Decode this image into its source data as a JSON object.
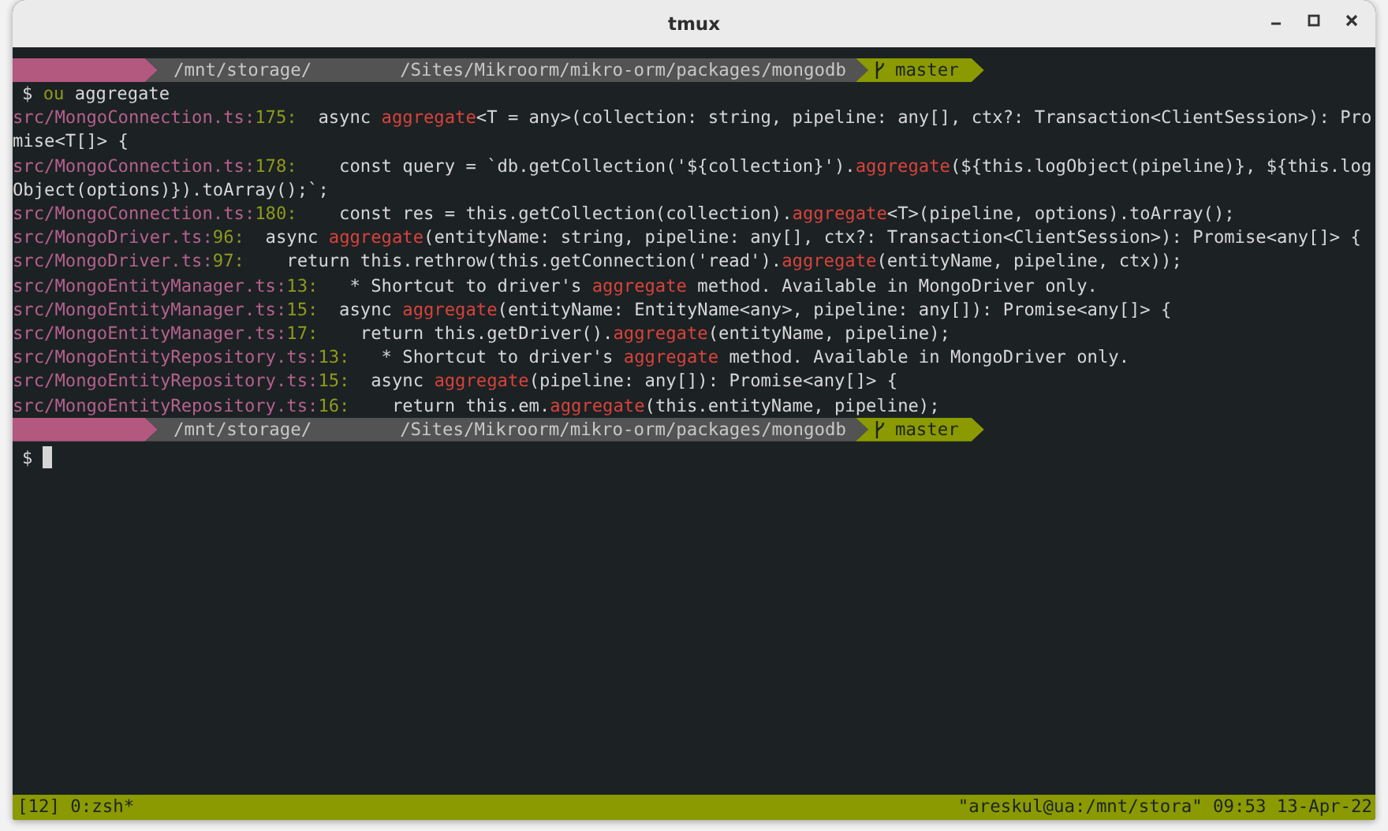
{
  "window": {
    "title": "tmux"
  },
  "prompts": [
    {
      "path_root": "/mnt/storage/",
      "path_rest": "/Sites/Mikroorm/mikro-orm/packages/mongodb",
      "branch": "master"
    },
    {
      "path_root": "/mnt/storage/",
      "path_rest": "/Sites/Mikroorm/mikro-orm/packages/mongodb",
      "branch": "master"
    }
  ],
  "command": {
    "symbol": "$",
    "program": "ou",
    "argument": "aggregate"
  },
  "results": [
    {
      "file": "src/MongoConnection.ts:",
      "line": "175:",
      "code": [
        {
          "text": "  async ",
          "match": false
        },
        {
          "text": "aggregate",
          "match": true
        },
        {
          "text": "<T = any>(collection: string, pipeline: any[], ctx?: Transaction<ClientSession>): Promise<T[]> {",
          "match": false
        }
      ]
    },
    {
      "file": "src/MongoConnection.ts:",
      "line": "178:",
      "code": [
        {
          "text": "    const query = `db.getCollection('${collection}').",
          "match": false
        },
        {
          "text": "aggregate",
          "match": true
        },
        {
          "text": "(${this.logObject(pipeline)}, ${this.logObject(options)}).toArray();`;",
          "match": false
        }
      ]
    },
    {
      "file": "src/MongoConnection.ts:",
      "line": "180:",
      "code": [
        {
          "text": "    const res = this.getCollection(collection).",
          "match": false
        },
        {
          "text": "aggregate",
          "match": true
        },
        {
          "text": "<T>(pipeline, options).toArray();",
          "match": false
        }
      ]
    },
    {
      "file": "src/MongoDriver.ts:",
      "line": "96:",
      "code": [
        {
          "text": "  async ",
          "match": false
        },
        {
          "text": "aggregate",
          "match": true
        },
        {
          "text": "(entityName: string, pipeline: any[], ctx?: Transaction<ClientSession>): Promise<any[]> {",
          "match": false
        }
      ]
    },
    {
      "file": "src/MongoDriver.ts:",
      "line": "97:",
      "code": [
        {
          "text": "    return this.rethrow(this.getConnection('read').",
          "match": false
        },
        {
          "text": "aggregate",
          "match": true
        },
        {
          "text": "(entityName, pipeline, ctx));",
          "match": false
        }
      ]
    },
    {
      "file": "src/MongoEntityManager.ts:",
      "line": "13:",
      "code": [
        {
          "text": "   * Shortcut to driver's ",
          "match": false
        },
        {
          "text": "aggregate",
          "match": true
        },
        {
          "text": " method. Available in MongoDriver only.",
          "match": false
        }
      ]
    },
    {
      "file": "src/MongoEntityManager.ts:",
      "line": "15:",
      "code": [
        {
          "text": "  async ",
          "match": false
        },
        {
          "text": "aggregate",
          "match": true
        },
        {
          "text": "(entityName: EntityName<any>, pipeline: any[]): Promise<any[]> {",
          "match": false
        }
      ]
    },
    {
      "file": "src/MongoEntityManager.ts:",
      "line": "17:",
      "code": [
        {
          "text": "    return this.getDriver().",
          "match": false
        },
        {
          "text": "aggregate",
          "match": true
        },
        {
          "text": "(entityName, pipeline);",
          "match": false
        }
      ]
    },
    {
      "file": "src/MongoEntityRepository.ts:",
      "line": "13:",
      "code": [
        {
          "text": "   * Shortcut to driver's ",
          "match": false
        },
        {
          "text": "aggregate",
          "match": true
        },
        {
          "text": " method. Available in MongoDriver only.",
          "match": false
        }
      ]
    },
    {
      "file": "src/MongoEntityRepository.ts:",
      "line": "15:",
      "code": [
        {
          "text": "  async ",
          "match": false
        },
        {
          "text": "aggregate",
          "match": true
        },
        {
          "text": "(pipeline: any[]): Promise<any[]> {",
          "match": false
        }
      ]
    },
    {
      "file": "src/MongoEntityRepository.ts:",
      "line": "16:",
      "code": [
        {
          "text": "    return this.em.",
          "match": false
        },
        {
          "text": "aggregate",
          "match": true
        },
        {
          "text": "(this.entityName, pipeline);",
          "match": false
        }
      ]
    }
  ],
  "input_prompt": {
    "symbol": "$"
  },
  "status_bar": {
    "session": "[12]",
    "window": "0:zsh*",
    "pane_title": "\"areskul@ua:/mnt/stora\"",
    "time": "09:53",
    "date": "13-Apr-22"
  }
}
